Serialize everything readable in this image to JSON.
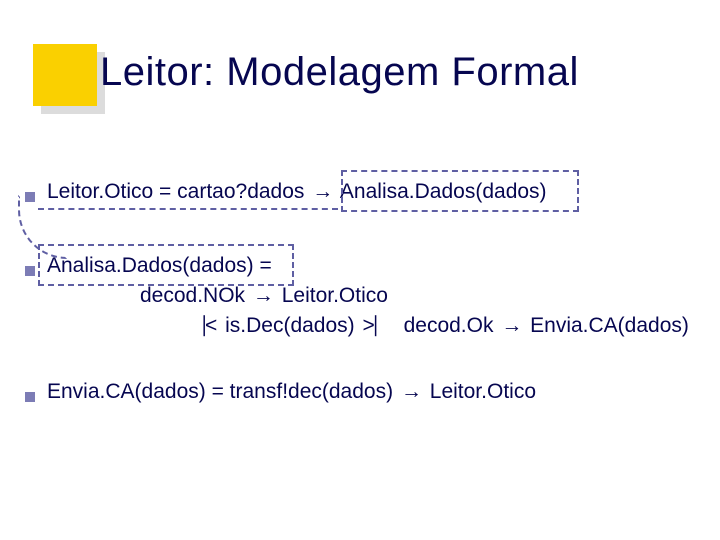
{
  "title": "Leitor: Modelagem Formal",
  "line1": {
    "lhs": "Leitor.Otico = cartao?dados ",
    "arrow": "→",
    "rhs": " Analisa.Dados(dados)"
  },
  "line2": {
    "text": "Analisa.Dados(dados) ="
  },
  "line3": {
    "a": "decod.NOk ",
    "arrow": "→",
    "b": " Leitor.Otico"
  },
  "line4": {
    "open": "⎹<",
    "guard": " is.Dec(dados) ",
    "close": ">⎸",
    "ok": " decod.Ok ",
    "arrow": "→",
    "tail": " Envia.CA(dados)"
  },
  "line5": {
    "lhs": "Envia.CA(dados) = transf!dec(dados) ",
    "arrow": "→",
    "rhs": " Leitor.Otico"
  }
}
